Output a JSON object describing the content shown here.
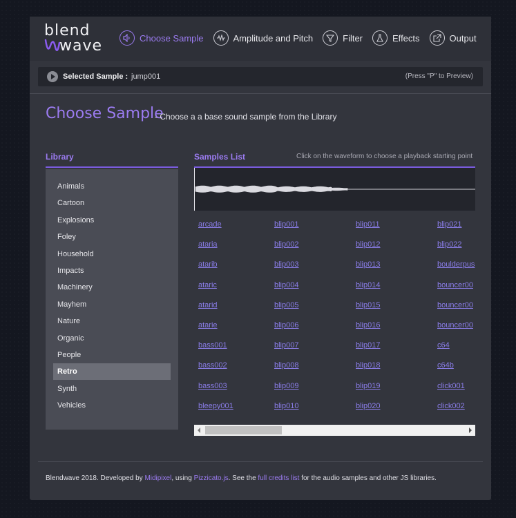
{
  "app": {
    "logo_line1": "blend",
    "logo_line2": "wave"
  },
  "nav": [
    {
      "label": "Choose Sample",
      "icon": "speaker-icon",
      "active": true
    },
    {
      "label": "Amplitude and Pitch",
      "icon": "waveform-icon"
    },
    {
      "label": "Filter",
      "icon": "funnel-icon"
    },
    {
      "label": "Effects",
      "icon": "flask-icon"
    },
    {
      "label": "Output",
      "icon": "export-icon"
    }
  ],
  "selected": {
    "label": "Selected Sample",
    "separator": ": ",
    "value": "jump001",
    "hint": "(Press \"P\" to Preview)"
  },
  "page": {
    "title": "Choose Sample",
    "subtitle": "- Choose a a base sound sample from the Library"
  },
  "library": {
    "heading": "Library",
    "items": [
      "Animals",
      "Cartoon",
      "Explosions",
      "Foley",
      "Household",
      "Impacts",
      "Machinery",
      "Mayhem",
      "Nature",
      "Organic",
      "People",
      "Retro",
      "Synth",
      "Vehicles"
    ],
    "active": "Retro"
  },
  "samples": {
    "heading": "Samples List",
    "hint": "Click on the waveform to choose a playback starting point",
    "columns": [
      [
        "arcade",
        "ataria",
        "atarib",
        "ataric",
        "atarid",
        "atarie",
        "bass001",
        "bass002",
        "bass003",
        "bleepy001"
      ],
      [
        "blip001",
        "blip002",
        "blip003",
        "blip004",
        "blip005",
        "blip006",
        "blip007",
        "blip008",
        "blip009",
        "blip010"
      ],
      [
        "blip011",
        "blip012",
        "blip013",
        "blip014",
        "blip015",
        "blip016",
        "blip017",
        "blip018",
        "blip019",
        "blip020"
      ],
      [
        "blip021",
        "blip022",
        "boulderpus",
        "bouncer00",
        "bouncer00",
        "bouncer00",
        "c64",
        "c64b",
        "click001",
        "click002"
      ]
    ]
  },
  "footer": {
    "text1": "Blendwave 2018. Developed by ",
    "link1": "Midipixel",
    "text2": ", using ",
    "link2": "Pizzicato.js",
    "text3": ". See the ",
    "link3": "full credits list",
    "text4": " for the audio samples and other JS libraries."
  },
  "colors": {
    "accent": "#9b7bf0",
    "link": "#8a7de8",
    "panel": "#33353d"
  }
}
